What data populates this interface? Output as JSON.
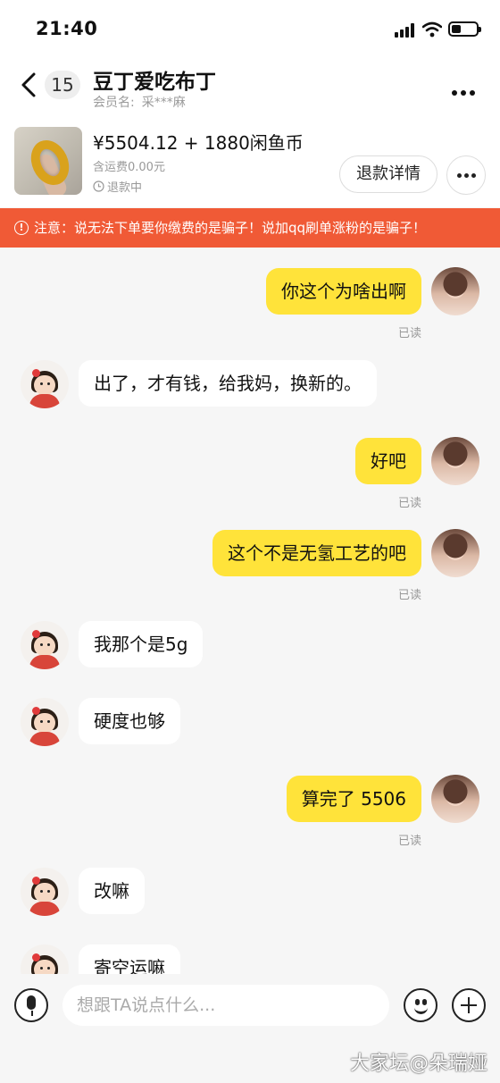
{
  "status_bar": {
    "time": "21:40"
  },
  "header": {
    "unread_count": "15",
    "title": "豆丁爱吃布丁",
    "member_label": "会员名:",
    "member_name": "采***麻"
  },
  "product": {
    "price": "¥5504.12 + 1880闲鱼币",
    "shipping": "含运费0.00元",
    "status": "退款中",
    "refund_detail_label": "退款详情"
  },
  "warning": {
    "text": "注意：说无法下单要你缴费的是骗子！说加qq刷单涨粉的是骗子！"
  },
  "messages": [
    {
      "from": "me",
      "text": "你这个为啥出啊",
      "read": "已读"
    },
    {
      "from": "other",
      "text": "出了，才有钱，给我妈，换新的。"
    },
    {
      "from": "me",
      "text": "好吧",
      "read": "已读"
    },
    {
      "from": "me",
      "text": "这个不是无氢工艺的吧",
      "read": "已读"
    },
    {
      "from": "other",
      "text": "我那个是5g"
    },
    {
      "from": "other",
      "text": "硬度也够"
    },
    {
      "from": "me",
      "text": "算完了 5506",
      "read": "已读"
    },
    {
      "from": "other",
      "text": "改嘛"
    },
    {
      "from": "other",
      "text": "寄空运嘛"
    }
  ],
  "input": {
    "placeholder": "想跟TA说点什么..."
  },
  "watermark": "大家坛@朵瑞娅",
  "colors": {
    "accent_yellow": "#ffe33a",
    "warning_red": "#f05a36",
    "background": "#f6f6f6"
  }
}
